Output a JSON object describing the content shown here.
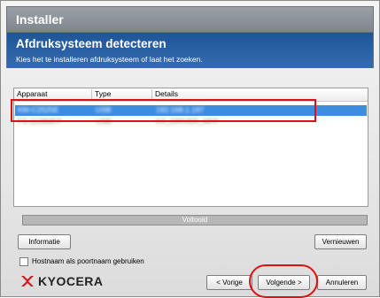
{
  "window": {
    "title": "Installer"
  },
  "page": {
    "heading": "Afdruksysteem detecteren",
    "subheading": "Kies het te installeren afdruksysteem of laat het zoeken."
  },
  "device_list": {
    "columns": [
      "Apparaat",
      "Type",
      "Details"
    ],
    "rows": [
      {
        "device": "KM-C2525E",
        "type": "USB",
        "details": "192.168.1.187",
        "selected": true
      },
      {
        "device": "FS-1128MFP",
        "type": "USB",
        "details": "KX_DRIVER_MFP",
        "selected": false
      }
    ]
  },
  "progress": {
    "label": "Voltooid",
    "value": 1.0
  },
  "buttons": {
    "info": "Informatie",
    "refresh": "Vernieuwen",
    "back": "< Vorige",
    "next": "Volgende >",
    "cancel": "Annuleren"
  },
  "options": {
    "hostname_label": "Hostnaam als poortnaam gebruiken",
    "hostname_checked": false
  },
  "brand": {
    "name": "KYOCERA",
    "color": "#d01818"
  },
  "colors": {
    "heading_band": "#2a5fa3",
    "selection": "#3c8ce0",
    "annotation": "#e01010"
  }
}
